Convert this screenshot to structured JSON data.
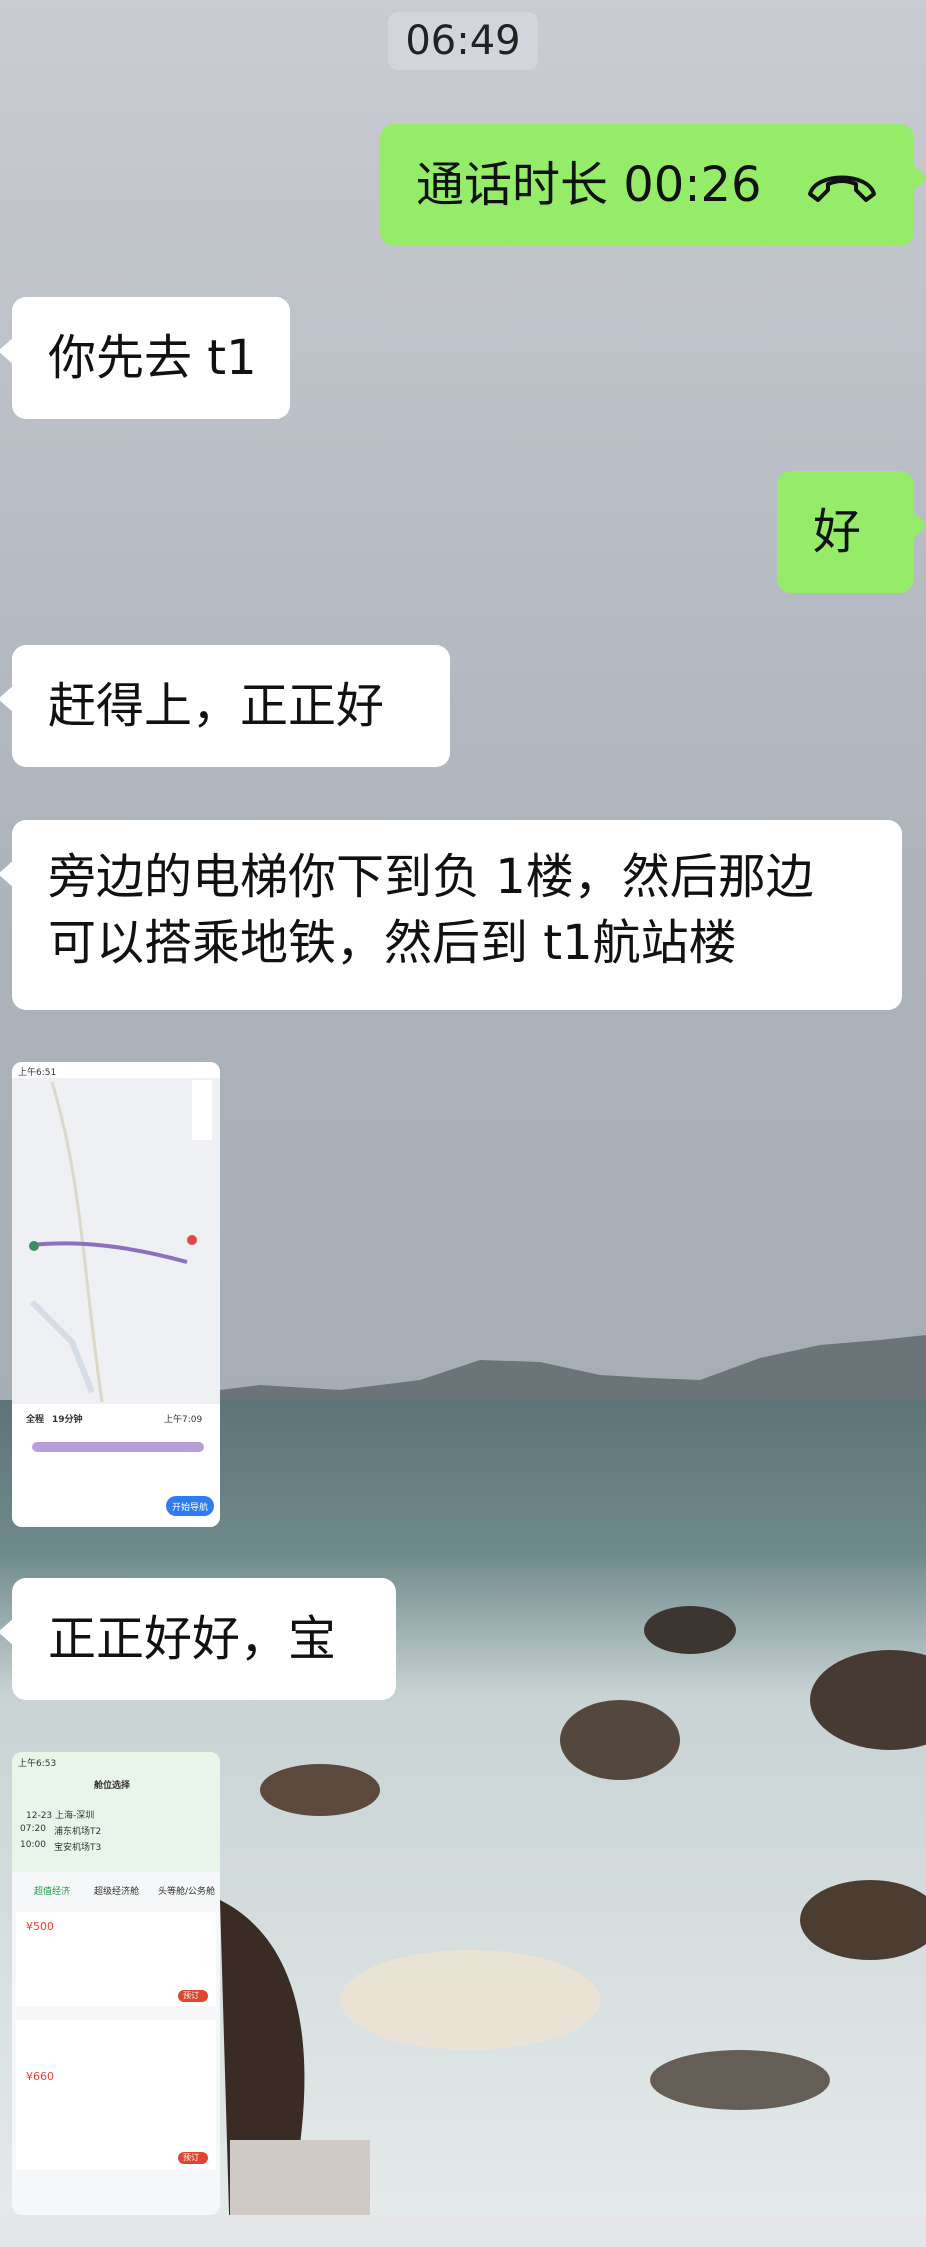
{
  "status": {
    "time": "06:49"
  },
  "messages": {
    "m1": {
      "text": "通话时长 00:26",
      "icon": "phone-hangup-icon"
    },
    "m2": {
      "text": "你先去 t1"
    },
    "m3": {
      "text": "好"
    },
    "m4": {
      "text": "赶得上，正正好"
    },
    "m5": {
      "line1": "旁边的电梯你下到负 1楼，然后那边",
      "line2": "可以搭乘地铁，然后到 t1航站楼"
    },
    "m6": {
      "type": "image",
      "icon": "map-screenshot"
    },
    "m7": {
      "text": "正正好好，宝"
    },
    "m8": {
      "type": "image",
      "icon": "booking-screenshot"
    }
  },
  "map_shot": {
    "status": "上午6:51",
    "total": "全程",
    "duration": "19分钟",
    "arrive": "上午7:09",
    "start_nav": "开始导航"
  },
  "booking_shot": {
    "status": "上午6:53",
    "title": "舱位选择",
    "date": "12-23 上海-深圳",
    "dep_time": "07:20",
    "dep_airport": "浦东机场T2",
    "arr_time": "10:00",
    "arr_airport": "宝安机场T3",
    "tab1": "超值经济",
    "tab2": "超级经济舱",
    "tab3": "头等舱/公务舱",
    "price1": "¥500",
    "price2": "¥660",
    "book": "预订"
  }
}
